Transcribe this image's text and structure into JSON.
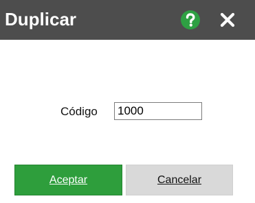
{
  "window": {
    "title": "Duplicar",
    "help_icon": "question-circle-icon",
    "close_icon": "close-x-icon"
  },
  "form": {
    "code_label": "Código",
    "code_value": "1000"
  },
  "buttons": {
    "accept_label": "Aceptar",
    "cancel_label": "Cancelar"
  },
  "colors": {
    "titlebar": "#4d4d4d",
    "help_icon": "#2ea043",
    "accept_button": "#2e9e3c",
    "cancel_button": "#d9d9d9"
  }
}
